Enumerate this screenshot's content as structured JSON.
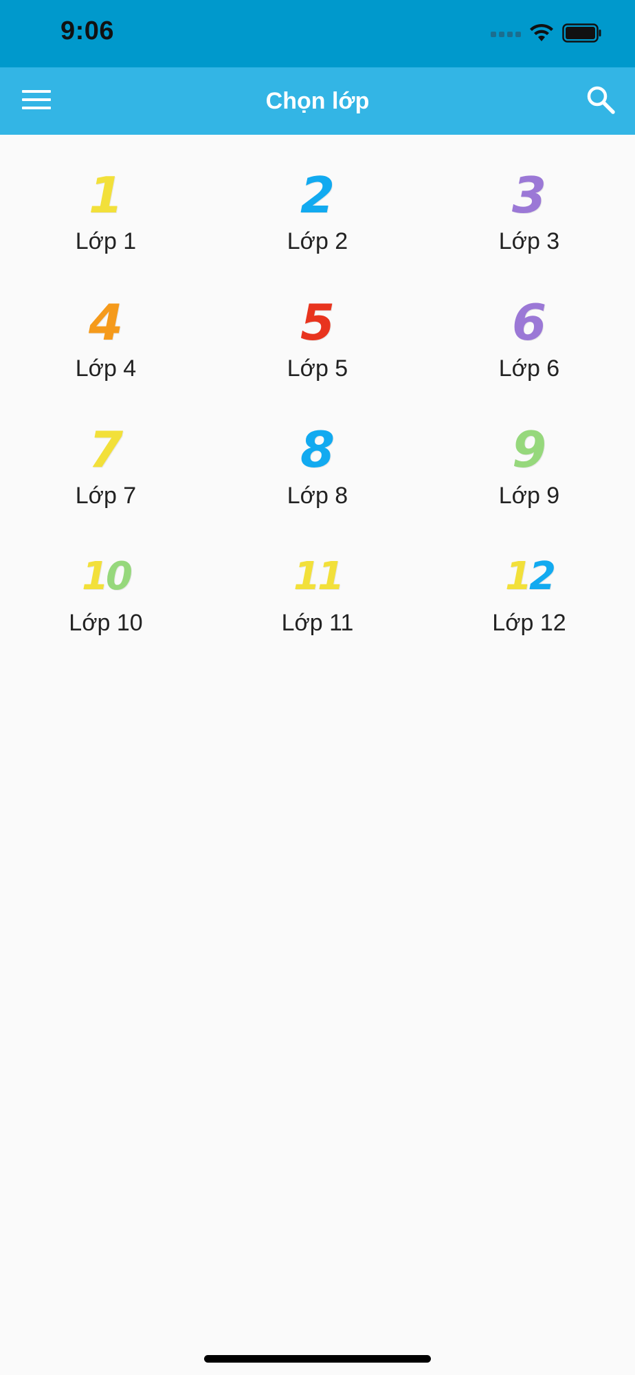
{
  "status_bar": {
    "time": "9:06",
    "icons": [
      "cellular-signal-icon",
      "wifi-icon",
      "battery-icon"
    ]
  },
  "app_bar": {
    "title": "Chọn lớp",
    "left_icon": "menu-icon",
    "right_icon": "search-icon",
    "background": "#33b5e5",
    "status_background": "#0099cc"
  },
  "grades": [
    {
      "label": "Lớp 1",
      "digits": [
        {
          "char": "1",
          "color": "#f2e03a"
        }
      ]
    },
    {
      "label": "Lớp 2",
      "digits": [
        {
          "char": "2",
          "color": "#12aaf0"
        }
      ]
    },
    {
      "label": "Lớp 3",
      "digits": [
        {
          "char": "3",
          "color": "#9b78d6"
        }
      ]
    },
    {
      "label": "Lớp 4",
      "digits": [
        {
          "char": "4",
          "color": "#f59a1b"
        }
      ]
    },
    {
      "label": "Lớp 5",
      "digits": [
        {
          "char": "5",
          "color": "#e8341e"
        }
      ]
    },
    {
      "label": "Lớp 6",
      "digits": [
        {
          "char": "6",
          "color": "#9b78d6"
        }
      ]
    },
    {
      "label": "Lớp 7",
      "digits": [
        {
          "char": "7",
          "color": "#f2e03a"
        }
      ]
    },
    {
      "label": "Lớp 8",
      "digits": [
        {
          "char": "8",
          "color": "#12aaf0"
        }
      ]
    },
    {
      "label": "Lớp 9",
      "digits": [
        {
          "char": "9",
          "color": "#96d87c"
        }
      ]
    },
    {
      "label": "Lớp 10",
      "digits": [
        {
          "char": "1",
          "color": "#f2e03a"
        },
        {
          "char": "0",
          "color": "#96d87c"
        }
      ]
    },
    {
      "label": "Lớp 11",
      "digits": [
        {
          "char": "1",
          "color": "#f2e03a"
        },
        {
          "char": "1",
          "color": "#f2e03a"
        }
      ]
    },
    {
      "label": "Lớp 12",
      "digits": [
        {
          "char": "1",
          "color": "#f2e03a"
        },
        {
          "char": "2",
          "color": "#12aaf0"
        }
      ]
    }
  ]
}
